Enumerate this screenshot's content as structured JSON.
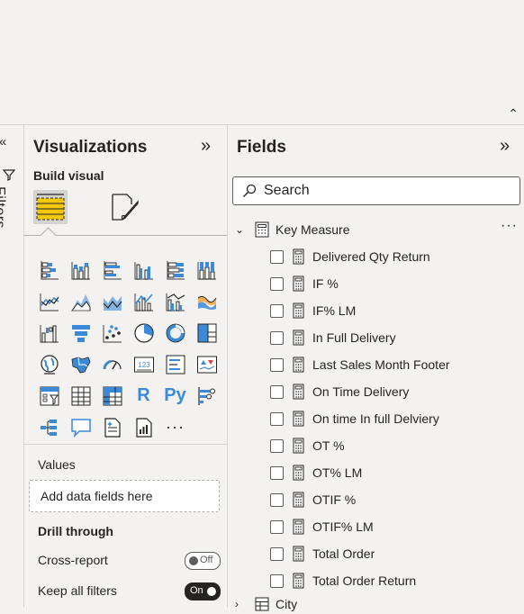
{
  "filters": {
    "label": "Filters"
  },
  "visualizations": {
    "title": "Visualizations",
    "build_label": "Build visual",
    "values_label": "Values",
    "drop_placeholder": "Add data fields here",
    "drill_label": "Drill through",
    "cross_report_label": "Cross-report",
    "cross_report_state": "Off",
    "keep_filters_label": "Keep all filters",
    "keep_filters_state": "On",
    "icons": [
      "stacked-bar-chart-icon",
      "stacked-column-chart-icon",
      "clustered-bar-chart-icon",
      "clustered-column-chart-icon",
      "100-stacked-bar-chart-icon",
      "100-stacked-column-chart-icon",
      "line-chart-icon",
      "area-chart-icon",
      "stacked-area-chart-icon",
      "line-and-stacked-column-icon",
      "line-and-clustered-column-icon",
      "ribbon-chart-icon",
      "waterfall-chart-icon",
      "funnel-chart-icon",
      "scatter-chart-icon",
      "pie-chart-icon",
      "donut-chart-icon",
      "treemap-icon",
      "map-icon",
      "filled-map-icon",
      "gauge-icon",
      "card-icon",
      "multi-row-card-icon",
      "kpi-icon",
      "slicer-icon",
      "table-icon",
      "matrix-icon",
      "r-script-visual-icon",
      "python-visual-icon",
      "key-influencers-icon",
      "decomposition-tree-icon",
      "qa-icon",
      "smart-narrative-icon",
      "paginated-report-icon",
      "more-visuals-icon"
    ],
    "r_label": "R",
    "py_label": "Py",
    "card_label": "123",
    "more_label": "···"
  },
  "fields": {
    "title": "Fields",
    "search_placeholder": "Search",
    "table_name": "Key Measure",
    "more_label": "···",
    "items": [
      "Delivered Qty Return",
      "IF %",
      "IF% LM",
      "In Full Delivery",
      "Last Sales Month Footer",
      "On Time Delivery",
      "On time In full Delviery",
      "OT %",
      "OT% LM",
      "OTIF %",
      "OTIF% LM",
      "Total Order",
      "Total Order Return"
    ],
    "next_table_name": "City"
  },
  "colors": {
    "accent_blue": "#3b8ad9",
    "accent_yellow": "#f2c811"
  }
}
